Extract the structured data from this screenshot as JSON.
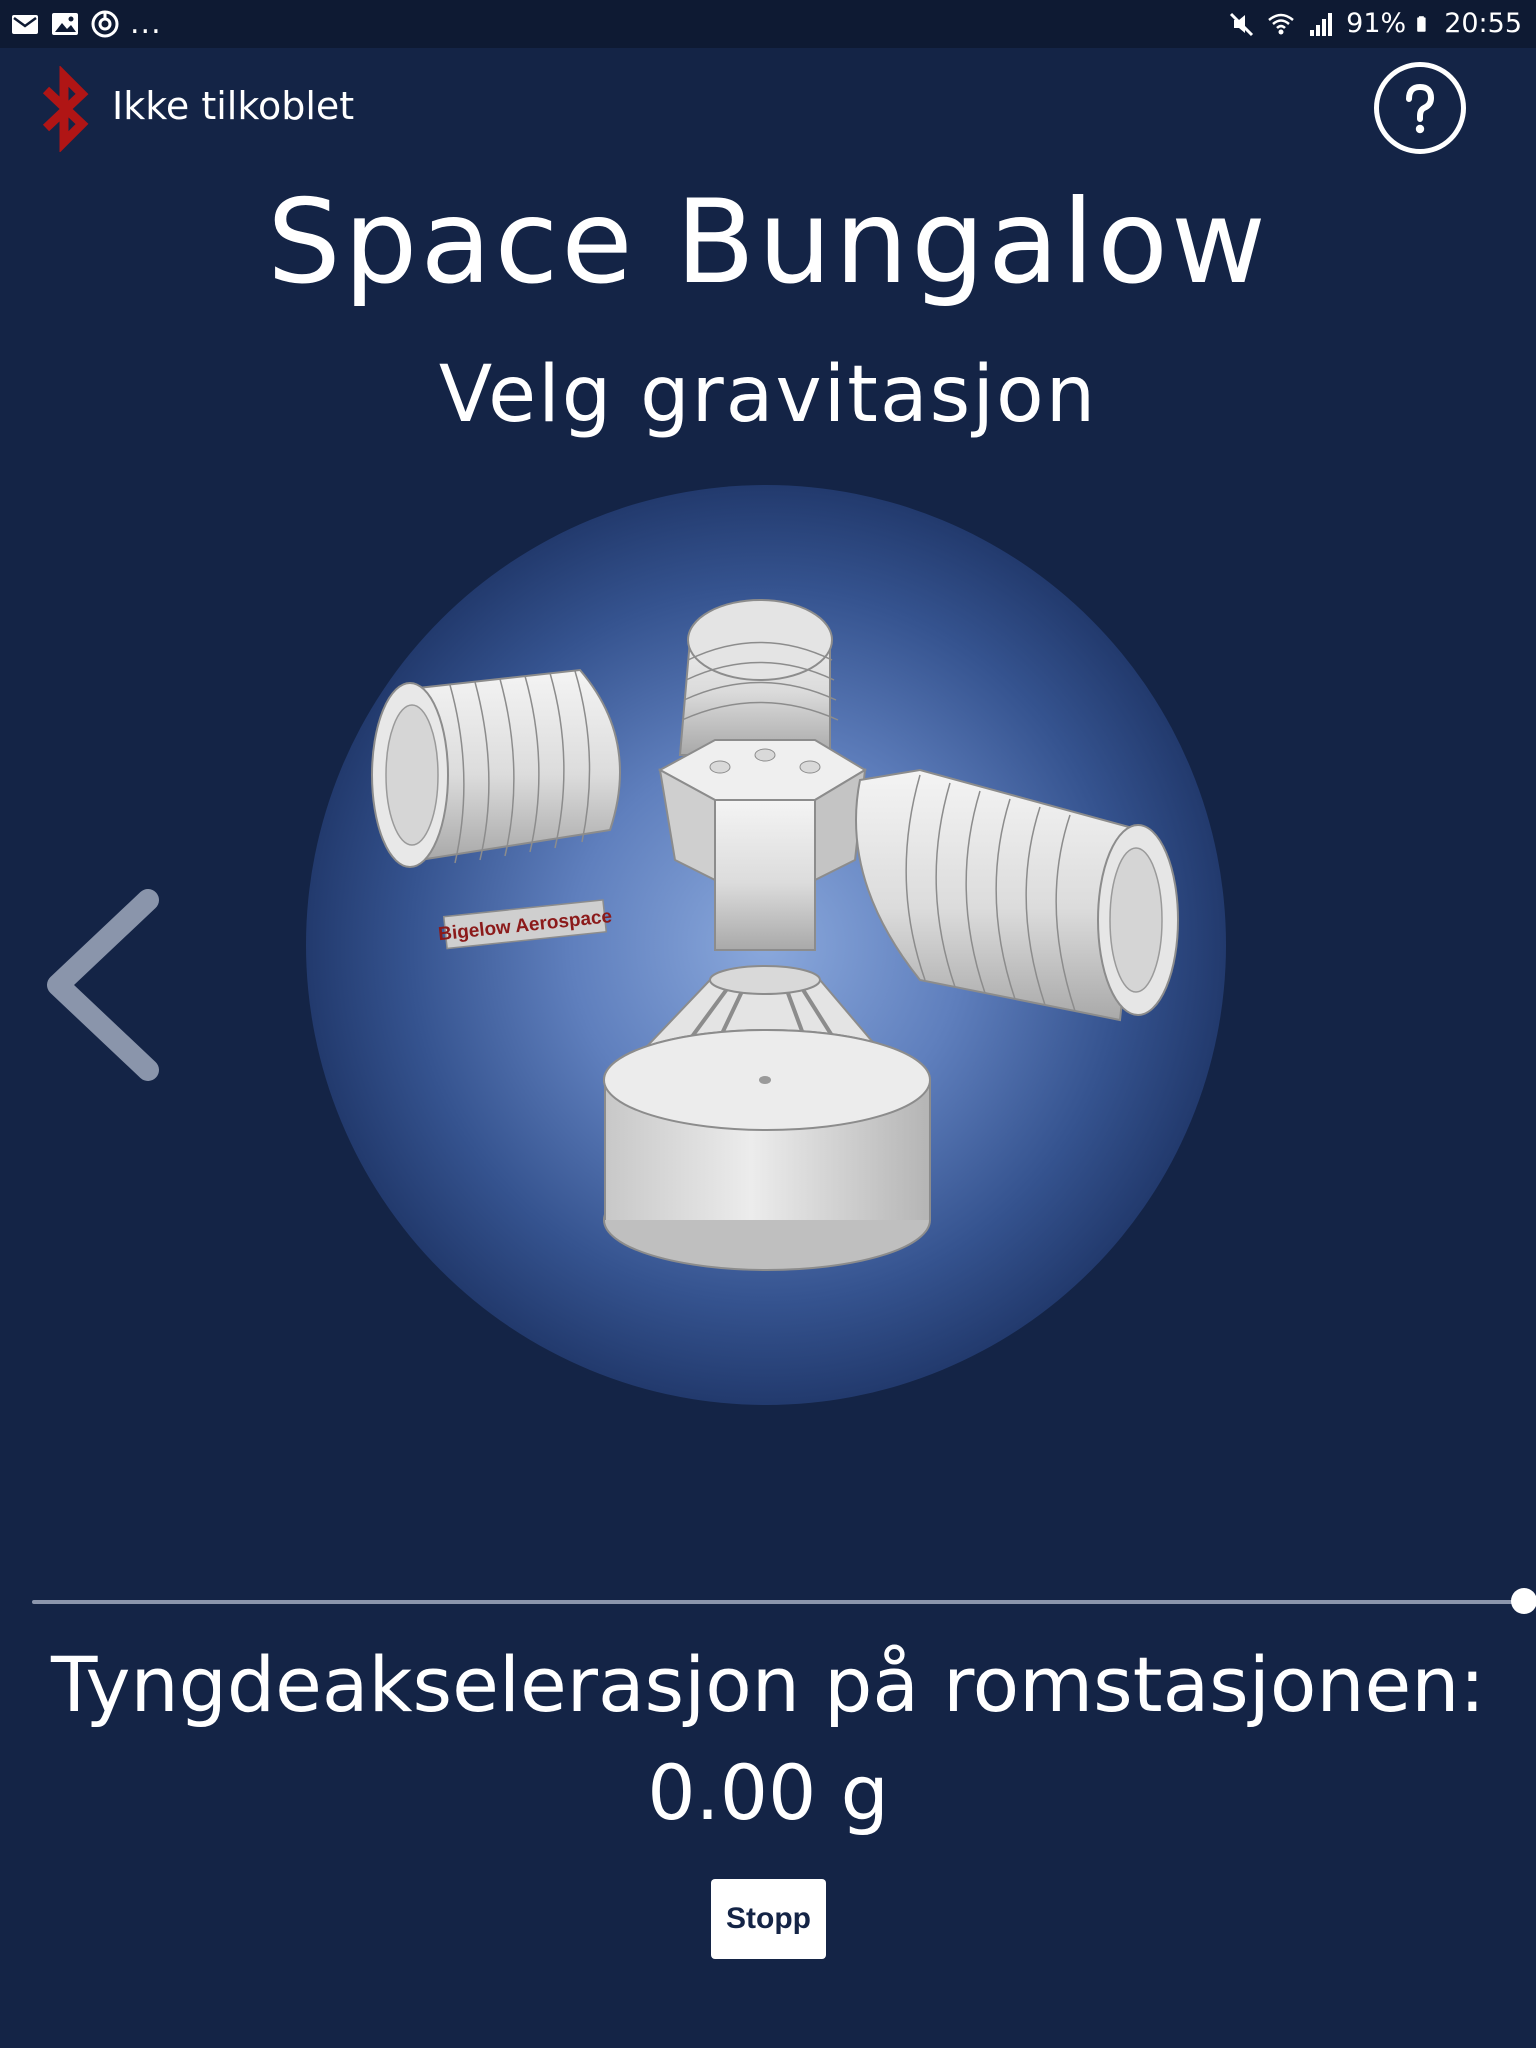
{
  "status_bar": {
    "left_icons": [
      "mail-icon",
      "image-icon",
      "sync-icon"
    ],
    "overflow": "...",
    "right_icons": [
      "mute-icon",
      "wifi-icon",
      "signal-icon"
    ],
    "battery": "91%",
    "time": "20:55"
  },
  "connection": {
    "icon": "bluetooth-icon",
    "status": "Ikke tilkoblet",
    "icon_color": "#b01515"
  },
  "help": {
    "icon": "question-icon"
  },
  "title": "Space Bungalow",
  "subtitle": "Velg gravitasjon",
  "station": {
    "label": "Bigelow Aerospace"
  },
  "navigation": {
    "prev_icon": "chevron-left-icon"
  },
  "slider": {
    "value_fraction": 1.0
  },
  "readout": {
    "label": "Tyngdeakselerasjon på romstasjonen:",
    "value": "0.00 g"
  },
  "controls": {
    "stop_label": "Stopp"
  },
  "colors": {
    "background": "#142446",
    "status_bar": "#0e1a33",
    "accent_red": "#b01515",
    "text": "#ffffff"
  }
}
